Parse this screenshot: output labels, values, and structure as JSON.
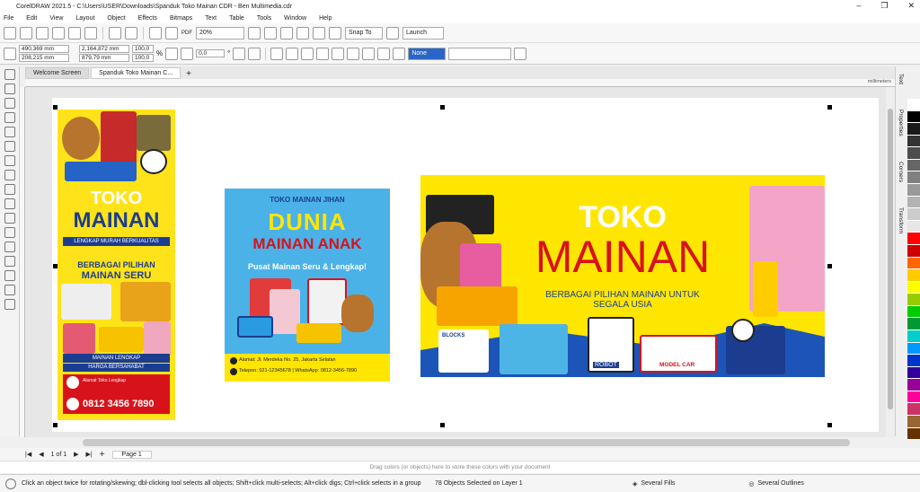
{
  "window": {
    "title": "CorelDRAW 2021.5 - C:\\Users\\USER\\Downloads\\Spanduk Toko Mainan CDR - Ben Multimedia.cdr",
    "min_icon": "minimize-icon",
    "max_icon": "restore-icon",
    "close_icon": "close-icon"
  },
  "menu": [
    "File",
    "Edit",
    "View",
    "Layout",
    "Object",
    "Effects",
    "Bitmaps",
    "Text",
    "Table",
    "Tools",
    "Window",
    "Help"
  ],
  "toolbar": {
    "zoom": "20%",
    "snap": "Snap To",
    "launch": "Launch",
    "pdf": "PDF"
  },
  "properties": {
    "x": "490,369 mm",
    "y": "208,215 mm",
    "w": "2,164,872 mm",
    "h": "879,79 mm",
    "sx": "100,0",
    "sy": "100,0",
    "pct": "%",
    "angle": "0,0",
    "angle_unit": "°",
    "fill_none": "None"
  },
  "tabs": [
    "Welcome Screen",
    "Spanduk Toko Mainan C..."
  ],
  "ruler_unit": "millimeters",
  "dockers": [
    "Text",
    "Properties",
    "Corners",
    "Transform"
  ],
  "pager": {
    "info": "1 of 1",
    "page": "Page 1"
  },
  "doc_palette_hint": "Drag colors (or objects) here to store these colors with your document",
  "status": {
    "hint": "Click an object twice for rotating/skewing; dbl-clicking tool selects all objects; Shift+click multi-selects; Alt+click digs; Ctrl+click selects in a group",
    "selection": "78 Objects Selected on Layer 1",
    "fills": "Several Fills",
    "outlines": "Several Outlines"
  },
  "design1": {
    "title1": "TOKO",
    "title2": "MAINAN",
    "ribbon": "LENGKAP MURAH BERKUALITAS",
    "sub1": "BERBAGAI PILIHAN",
    "sub2": "MAINAN SERU",
    "tag1": "MAINAN LENGKAP",
    "tag2": "HARGA BERSAHABAT",
    "addr": "Alamat Toko Lengkap",
    "phone": "0812 3456 7890"
  },
  "design2": {
    "top": "TOKO MAINAN JIHAN",
    "title1": "DUNIA",
    "title2": "MAINAN ANAK",
    "sub": "Pusat Mainan Seru & Lengkap!",
    "addr": "Alamat: Jl. Merdeka No. 25, Jakarta Selatan",
    "phone": "Telepon: 021-12345678 | WhatsApp: 0812-3456-7890"
  },
  "design3": {
    "title1": "TOKO",
    "title2": "MAINAN",
    "sub1": "BERBAGAI PILIHAN MAINAN UNTUK",
    "sub2": "SEGALA USIA",
    "blocks": "BLOCKS",
    "robot": "ROBOT",
    "model": "MODEL CAR"
  },
  "palette": [
    "#ffffff",
    "#000000",
    "#1a1a1a",
    "#333333",
    "#4d4d4d",
    "#666666",
    "#808080",
    "#999999",
    "#b3b3b3",
    "#cccccc",
    "#e6e6e6",
    "#ff0000",
    "#cc0000",
    "#ff6600",
    "#ffcc00",
    "#ffff00",
    "#99cc00",
    "#00cc00",
    "#009933",
    "#00cccc",
    "#0099ff",
    "#0033cc",
    "#330099",
    "#990099",
    "#ff0099",
    "#cc3366",
    "#996633",
    "#663300"
  ]
}
